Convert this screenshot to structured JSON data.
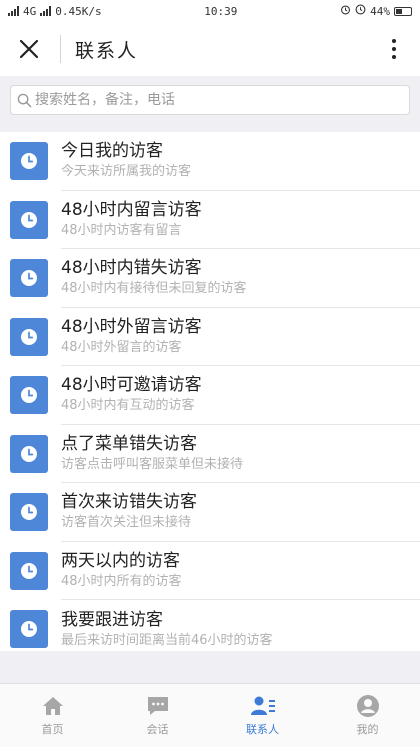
{
  "status": {
    "signal": "4G",
    "speed": "0.45K/s",
    "time": "10:39",
    "battery": "44%"
  },
  "header": {
    "title": "联系人"
  },
  "search": {
    "placeholder": "搜索姓名，备注，电话"
  },
  "list": [
    {
      "title": "今日我的访客",
      "subtitle": "今天来访所属我的访客"
    },
    {
      "title": "48小时内留言访客",
      "subtitle": "48小时内访客有留言"
    },
    {
      "title": "48小时内错失访客",
      "subtitle": "48小时内有接待但未回复的访客"
    },
    {
      "title": "48小时外留言访客",
      "subtitle": "48小时外留言的访客"
    },
    {
      "title": "48小时可邀请访客",
      "subtitle": "48小时内有互动的访客"
    },
    {
      "title": "点了菜单错失访客",
      "subtitle": "访客点击呼叫客服菜单但未接待"
    },
    {
      "title": "首次来访错失访客",
      "subtitle": "访客首次关注但未接待"
    },
    {
      "title": "两天以内的访客",
      "subtitle": "48小时内所有的访客"
    },
    {
      "title": "我要跟进访客",
      "subtitle": "最后来访时间距离当前46小时的访客"
    }
  ],
  "tabs": [
    {
      "label": "首页"
    },
    {
      "label": "会话"
    },
    {
      "label": "联系人"
    },
    {
      "label": "我的"
    }
  ],
  "colors": {
    "accent": "#3d7bd6",
    "icon_bg": "#4e87d8",
    "tab_inactive": "#9a9a9a"
  }
}
